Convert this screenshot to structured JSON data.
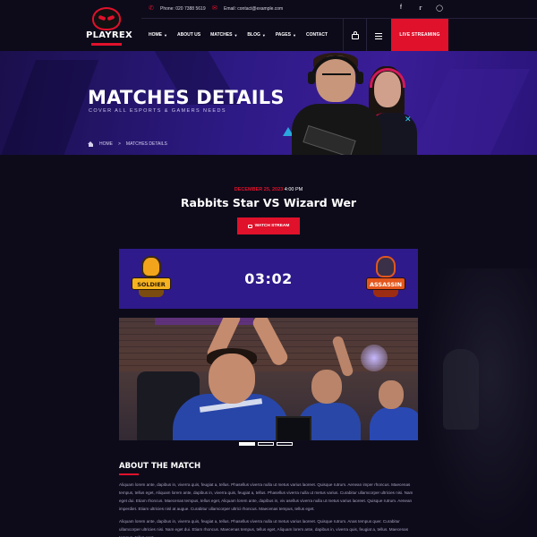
{
  "brand": {
    "name": "PLAYREX"
  },
  "topbar": {
    "phone": "Phone: 020 7388 5619",
    "email": "Email: contact@example.com",
    "social": [
      "facebook-icon",
      "twitter-icon",
      "instagram-icon"
    ]
  },
  "nav": {
    "items": [
      {
        "label": "HOME",
        "dropdown": true
      },
      {
        "label": "ABOUT US",
        "dropdown": false
      },
      {
        "label": "MATCHES",
        "dropdown": true
      },
      {
        "label": "BLOG",
        "dropdown": true
      },
      {
        "label": "PAGES",
        "dropdown": true
      },
      {
        "label": "CONTACT",
        "dropdown": false
      }
    ],
    "live_label": "LIVE STREAMING"
  },
  "hero": {
    "title": "MATCHES DETAILS",
    "subtitle": "COVER ALL ESPORTS & GAMERS NEEDS",
    "breadcrumb": {
      "home": "HOME",
      "separator": ">",
      "current": "MATCHES DETAILS"
    }
  },
  "match": {
    "date": "DECEMBER 25, 2023",
    "time": "4:00 PM",
    "title": "Rabbits Star VS Wizard Wer",
    "watch_label": "WATCH STREAM",
    "score": "03:02",
    "team_left": {
      "name": "SOLDIER"
    },
    "team_right": {
      "name": "ASSASSIN"
    }
  },
  "slider": {
    "count": 3,
    "active_index": 0
  },
  "about": {
    "heading": "ABOUT THE MATCH",
    "paragraph1": "Aliquam lorem ante, dapibus in, viverra quis, feugiat a, tellus. Phasellus viverra nulla ut metus varius laoreet. Quisque rutrum. Aenean imper rhoncus. Maecenas tempus, tellus eget, Aliquam lorem ante, dapibus in, viverra quis, feugiat a, tellus. Phasellus viverra nulla ut metus varius. Curabitur ullamcorper ultricies nisi. Nam eget dui. Etiam rhoncus. Maecenas tempus, tellus eget, Aliquam lorem ante, dapibus in, viv asellus viverra nulla ut metus varius laoreet. Quisque rutrum. Aenean imperdiet. Etiam ultricies nisl at augue. Curabitur ullamcorper ultrici rhoncus. Maecenas tempus, tellus eget.",
    "paragraph2": "Aliquam lorem ante, dapibus in, viverra quis, feugiat a, tellus. Phasellus viverra nulla ut metus varius laoreet. Quisque rutrum. Anas tempus quer. Curabitur ullamcorper ultricies nisi. Nam eget dui. Etiam rhoncus. Maecenas tempus, tellus eget, Aliquam lorem ante, dapibus in, viverra quis, feugiat a, tellus. Maecenas tempus, tellus eget."
  },
  "colors": {
    "accent": "#e0112b",
    "hero_purple": "#2e1a86",
    "score_box": "#2e1a8a",
    "background": "#0d0b1a"
  }
}
